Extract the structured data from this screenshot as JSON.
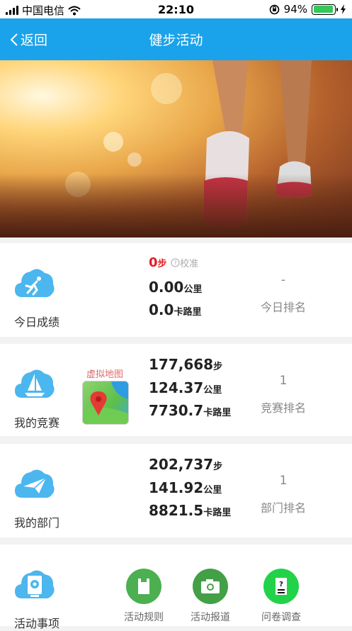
{
  "status_bar": {
    "carrier": "中国电信",
    "time": "22:10",
    "battery_percent": "94%",
    "battery_level": 0.94
  },
  "nav": {
    "back_label": "返回",
    "title": "健步活动"
  },
  "today": {
    "label": "今日成绩",
    "steps": "0",
    "steps_unit": "步",
    "calibrate": "校准",
    "distance": "0.00",
    "distance_unit": "公里",
    "calories": "0.0",
    "calories_unit": "卡路里",
    "rank_value": "-",
    "rank_label": "今日排名"
  },
  "competition": {
    "label": "我的竞赛",
    "map_label": "虚拟地图",
    "steps": "177,668",
    "steps_unit": "步",
    "distance": "124.37",
    "distance_unit": "公里",
    "calories": "7730.7",
    "calories_unit": "卡路里",
    "rank_value": "1",
    "rank_label": "竞赛排名"
  },
  "department": {
    "label": "我的部门",
    "steps": "202,737",
    "steps_unit": "步",
    "distance": "141.92",
    "distance_unit": "公里",
    "calories": "8821.5",
    "calories_unit": "卡路里",
    "rank_value": "1",
    "rank_label": "部门排名"
  },
  "events": {
    "label": "活动事项",
    "tools": [
      {
        "label": "活动规则",
        "color": "#4caf50"
      },
      {
        "label": "活动报道",
        "color": "#43a047"
      },
      {
        "label": "问卷调查",
        "color": "#22d34a"
      }
    ]
  },
  "colors": {
    "nav": "#1aa3ea",
    "accent_red": "#e51c23",
    "cloud_blue": "#4cb6ee"
  }
}
